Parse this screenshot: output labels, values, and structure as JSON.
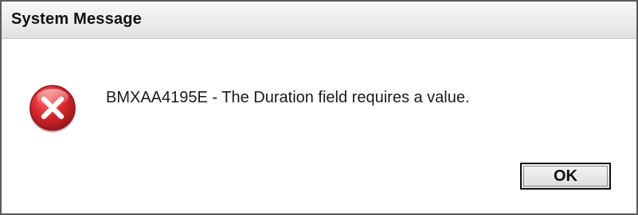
{
  "dialog": {
    "title": "System Message",
    "message": "BMXAA4195E - The Duration field requires a value.",
    "icon": "error-x-circle-icon",
    "ok_label": "OK"
  },
  "colors": {
    "icon_red": "#d8262b",
    "icon_dark_red": "#9e1518",
    "border": "#5b5b5b",
    "titlebar": "#ececec"
  }
}
